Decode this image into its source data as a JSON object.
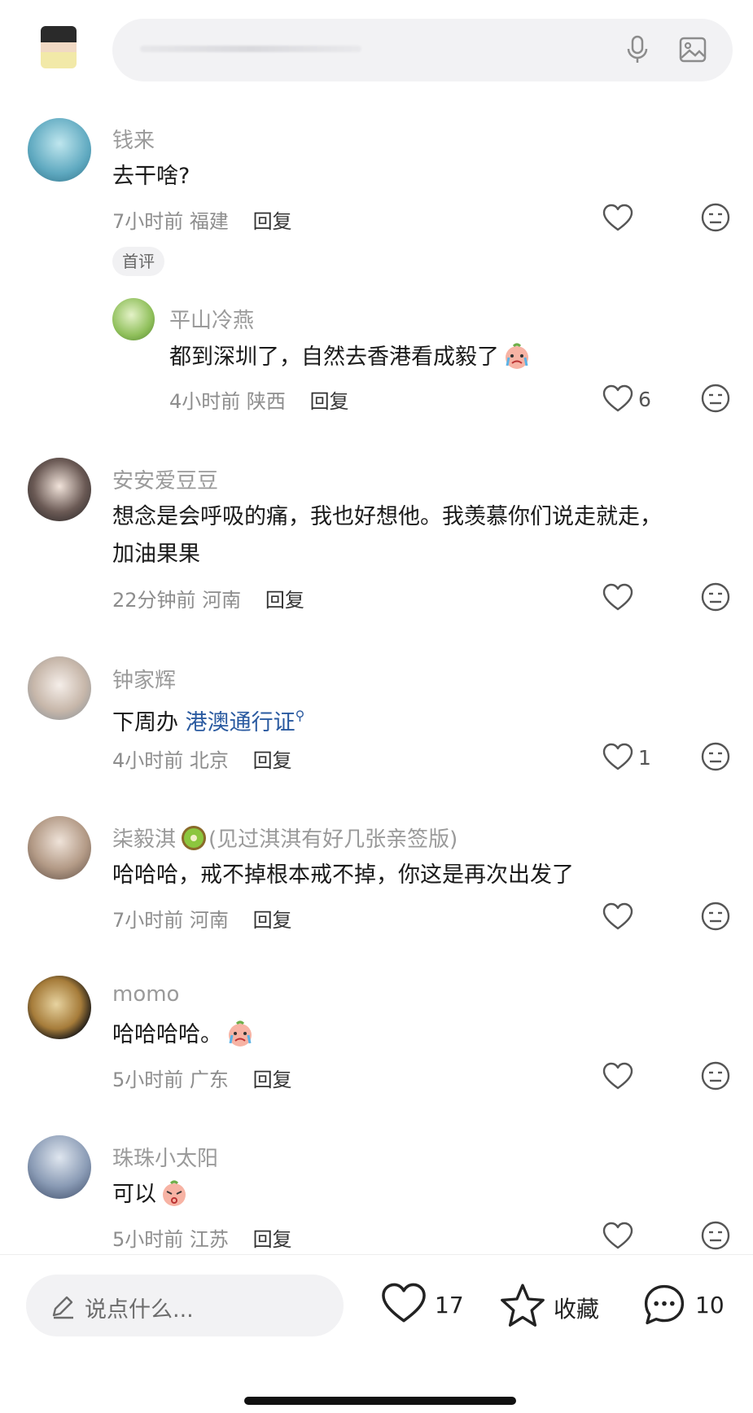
{
  "search": {
    "placeholder": ""
  },
  "comments": [
    {
      "user": "钱来",
      "text": "去干啥?",
      "time": "7小时前",
      "location": "福建",
      "reply": "回复",
      "likes": "",
      "tag": "首评"
    },
    {
      "user": "平山冷燕",
      "text": "都到深圳了，自然去香港看成毅了",
      "time": "4小时前",
      "location": "陕西",
      "reply": "回复",
      "likes": "6",
      "is_reply": true
    },
    {
      "user": "安安爱豆豆",
      "text_line1": "想念是会呼吸的痛，我也好想他。我羡慕你们说走就走，",
      "text_line2": "加油果果",
      "time": "22分钟前",
      "location": "河南",
      "reply": "回复",
      "likes": ""
    },
    {
      "user": "钟家辉",
      "text_prefix": "下周办 ",
      "text_link": "港澳通行证",
      "time": "4小时前",
      "location": "北京",
      "reply": "回复",
      "likes": "1"
    },
    {
      "user": "柒毅淇",
      "user_suffix": "(见过淇淇有好几张亲签版)",
      "text": "哈哈哈，戒不掉根本戒不掉，你这是再次出发了",
      "time": "7小时前",
      "location": "河南",
      "reply": "回复",
      "likes": ""
    },
    {
      "user": "momo",
      "text": "哈哈哈哈。",
      "time": "5小时前",
      "location": "广东",
      "reply": "回复",
      "likes": ""
    },
    {
      "user": "珠珠小太阳",
      "text": "可以",
      "time": "5小时前",
      "location": "江苏",
      "reply": "回复",
      "likes": ""
    }
  ],
  "bottom": {
    "input_placeholder": "说点什么...",
    "like_count": "17",
    "collect_label": "收藏",
    "comment_count": "10"
  },
  "icons": {
    "mic": "microphone-icon",
    "image": "image-icon",
    "like": "heart-icon",
    "dislike": "neutral-face-icon",
    "pencil": "pencil-icon",
    "star": "star-icon",
    "comment": "chat-bubble-icon"
  }
}
